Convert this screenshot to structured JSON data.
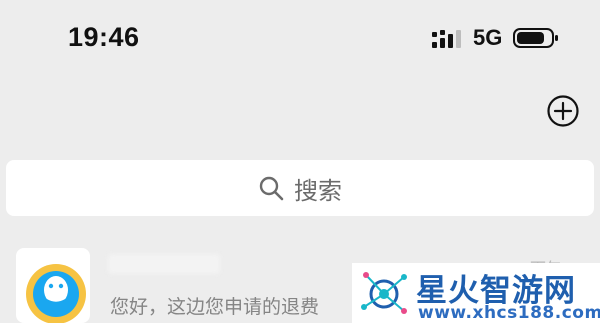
{
  "status_bar": {
    "time": "19:46",
    "network": "5G",
    "signal_icon": "cellular-signal-icon",
    "battery_icon": "battery-icon"
  },
  "header": {
    "add_icon": "plus-circle-icon"
  },
  "search": {
    "icon": "search-icon",
    "placeholder": "搜索"
  },
  "chats": [
    {
      "avatar_icon": "qq-penguin-icon",
      "time": "下午 7:37",
      "preview": "您好，这边您申请的退费"
    }
  ],
  "watermark": {
    "title": "星火智游网",
    "url": "www.xhcs188.com"
  },
  "colors": {
    "background": "#ededed",
    "surface": "#ffffff",
    "watermark_blue": "#1f5fae",
    "avatar_blue": "#1aa7f0",
    "avatar_yellow": "#f6c343"
  }
}
